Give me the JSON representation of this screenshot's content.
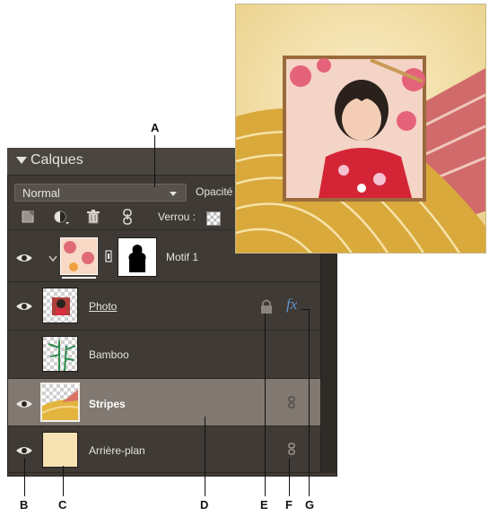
{
  "panel": {
    "title": "Calques",
    "blend_mode": "Normal",
    "opacity_label": "Opacité",
    "lock_label": "Verrou :"
  },
  "layers": [
    {
      "name": "Motif 1",
      "visible": true
    },
    {
      "name": "Photo",
      "visible": true
    },
    {
      "name": "Bamboo",
      "visible": false
    },
    {
      "name": "Stripes",
      "visible": true,
      "selected": true
    },
    {
      "name": "Arrière-plan",
      "visible": true
    }
  ],
  "fx_label": "fx",
  "callouts": [
    "A",
    "B",
    "C",
    "D",
    "E",
    "F",
    "G"
  ],
  "colors": {
    "panel_bg": "#3f3a35",
    "selected_row": "#807871",
    "canvas_cream": "#f4e1a6",
    "canvas_gold": "#d8aa39",
    "canvas_red": "#cf6a66",
    "fx_blue": "#5f93c9"
  },
  "icons": [
    "eye-icon",
    "link-icon",
    "lock-icon",
    "new-layer-icon",
    "adjustment-icon",
    "trash-icon",
    "chain-icon",
    "checkerboard-icon"
  ]
}
